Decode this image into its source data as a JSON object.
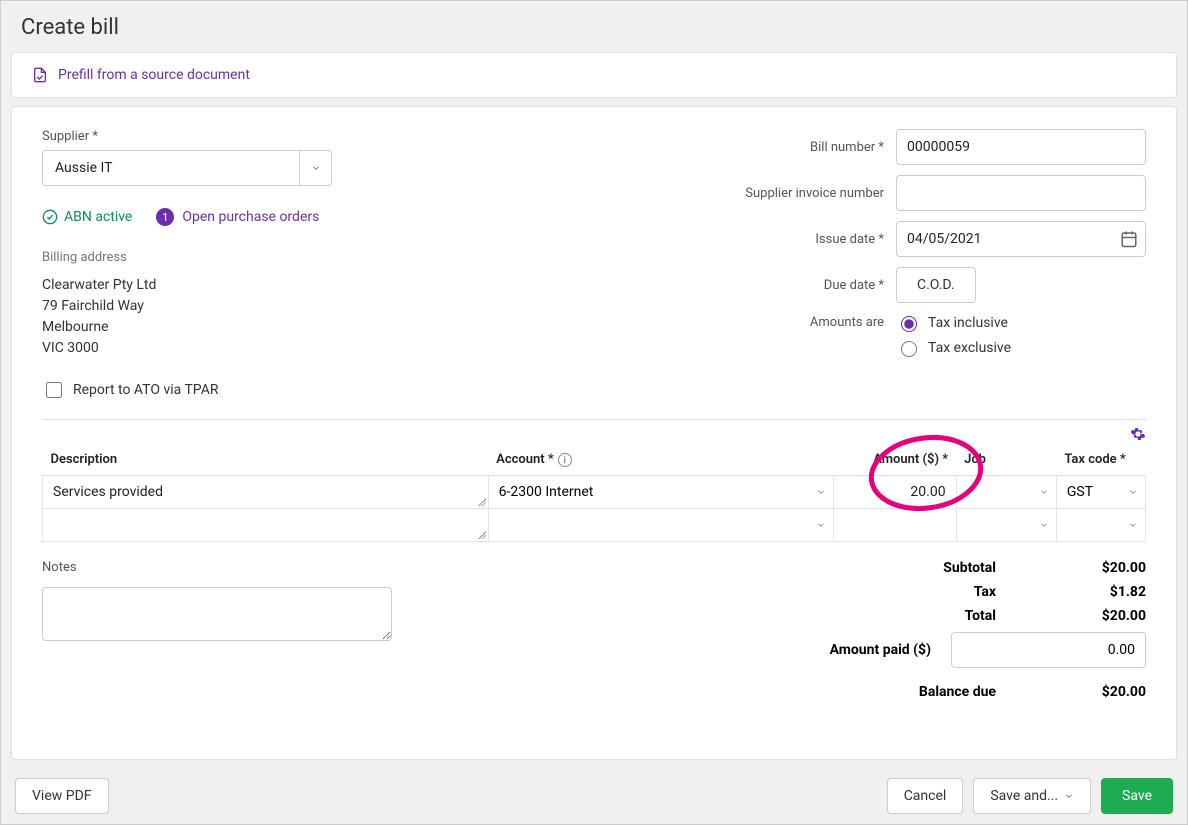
{
  "page": {
    "title": "Create bill"
  },
  "prefill": {
    "label": "Prefill from a source document"
  },
  "supplier": {
    "label": "Supplier *",
    "value": "Aussie IT",
    "abn_status": "ABN active",
    "open_po_badge": "1",
    "open_po_label": "Open purchase orders"
  },
  "billing": {
    "heading": "Billing address",
    "line1": "Clearwater Pty Ltd",
    "line2": "79 Fairchild Way",
    "line3": "Melbourne",
    "line4": "VIC 3000"
  },
  "tpar": {
    "label": "Report to ATO via TPAR"
  },
  "details": {
    "bill_number_label": "Bill number *",
    "bill_number": "00000059",
    "supplier_inv_label": "Supplier invoice number",
    "supplier_inv": "",
    "issue_date_label": "Issue date *",
    "issue_date": "04/05/2021",
    "due_date_label": "Due date *",
    "due_date_button": "C.O.D.",
    "amounts_are_label": "Amounts are",
    "tax_inclusive": "Tax inclusive",
    "tax_exclusive": "Tax exclusive"
  },
  "table": {
    "headers": {
      "description": "Description",
      "account": "Account *",
      "amount": "Amount ($) *",
      "job": "Job",
      "tax_code": "Tax code *"
    },
    "rows": [
      {
        "description": "Services provided",
        "account": "6-2300 Internet",
        "amount": "20.00",
        "job": "",
        "tax_code": "GST"
      },
      {
        "description": "",
        "account": "",
        "amount": "",
        "job": "",
        "tax_code": ""
      }
    ]
  },
  "notes": {
    "label": "Notes",
    "value": ""
  },
  "totals": {
    "subtotal_label": "Subtotal",
    "subtotal": "$20.00",
    "tax_label": "Tax",
    "tax": "$1.82",
    "total_label": "Total",
    "total": "$20.00",
    "amount_paid_label": "Amount paid ($)",
    "amount_paid": "0.00",
    "balance_due_label": "Balance due",
    "balance_due": "$20.00"
  },
  "footer": {
    "view_pdf": "View PDF",
    "cancel": "Cancel",
    "save_and": "Save and...",
    "save": "Save"
  }
}
